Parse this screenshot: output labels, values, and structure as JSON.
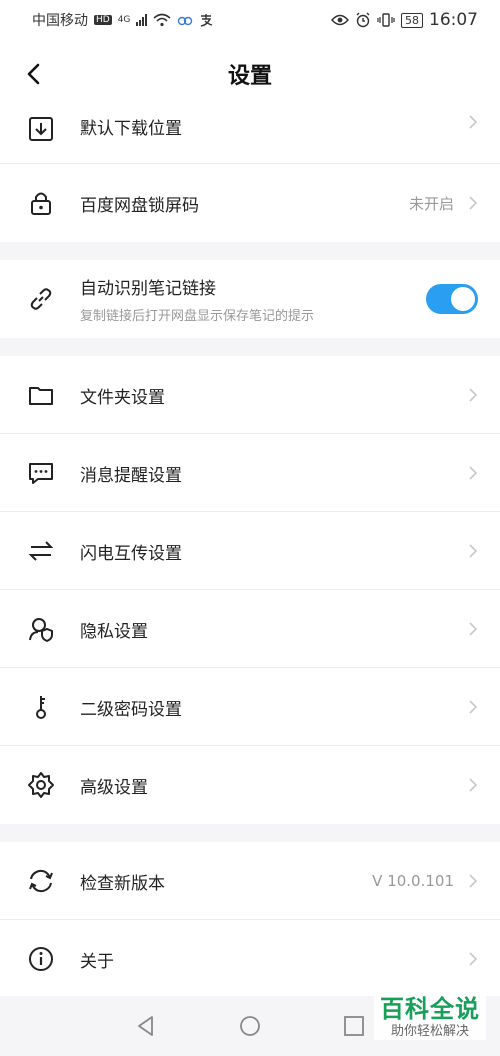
{
  "status_bar": {
    "carrier": "中国移动",
    "hd": "HD",
    "network": "4G",
    "battery": "58",
    "time": "16:07"
  },
  "header": {
    "title": "设置",
    "back_icon": "chevron-left-icon"
  },
  "settings": [
    {
      "id": "download",
      "icon": "download-icon",
      "label": "默认下载位置"
    },
    {
      "id": "lock",
      "icon": "lock-icon",
      "label": "百度网盘锁屏码",
      "value": "未开启"
    },
    {
      "id": "note-link",
      "icon": "link-icon",
      "label": "自动识别笔记链接",
      "sub": "复制链接后打开网盘显示保存笔记的提示",
      "toggle_on": true
    },
    {
      "id": "folder",
      "icon": "folder-icon",
      "label": "文件夹设置"
    },
    {
      "id": "message",
      "icon": "message-icon",
      "label": "消息提醒设置"
    },
    {
      "id": "transfer",
      "icon": "transfer-icon",
      "label": "闪电互传设置"
    },
    {
      "id": "privacy",
      "icon": "privacy-icon",
      "label": "隐私设置"
    },
    {
      "id": "password",
      "icon": "key-icon",
      "label": "二级密码设置"
    },
    {
      "id": "advanced",
      "icon": "gear-icon",
      "label": "高级设置"
    },
    {
      "id": "update",
      "icon": "refresh-icon",
      "label": "检查新版本",
      "value": "V 10.0.101"
    },
    {
      "id": "about",
      "icon": "info-icon",
      "label": "关于"
    }
  ],
  "watermark": {
    "main": "百科全说",
    "sub": "助你轻松解决"
  },
  "colors": {
    "accent": "#2a9ef0",
    "watermark": "#18a05a"
  }
}
